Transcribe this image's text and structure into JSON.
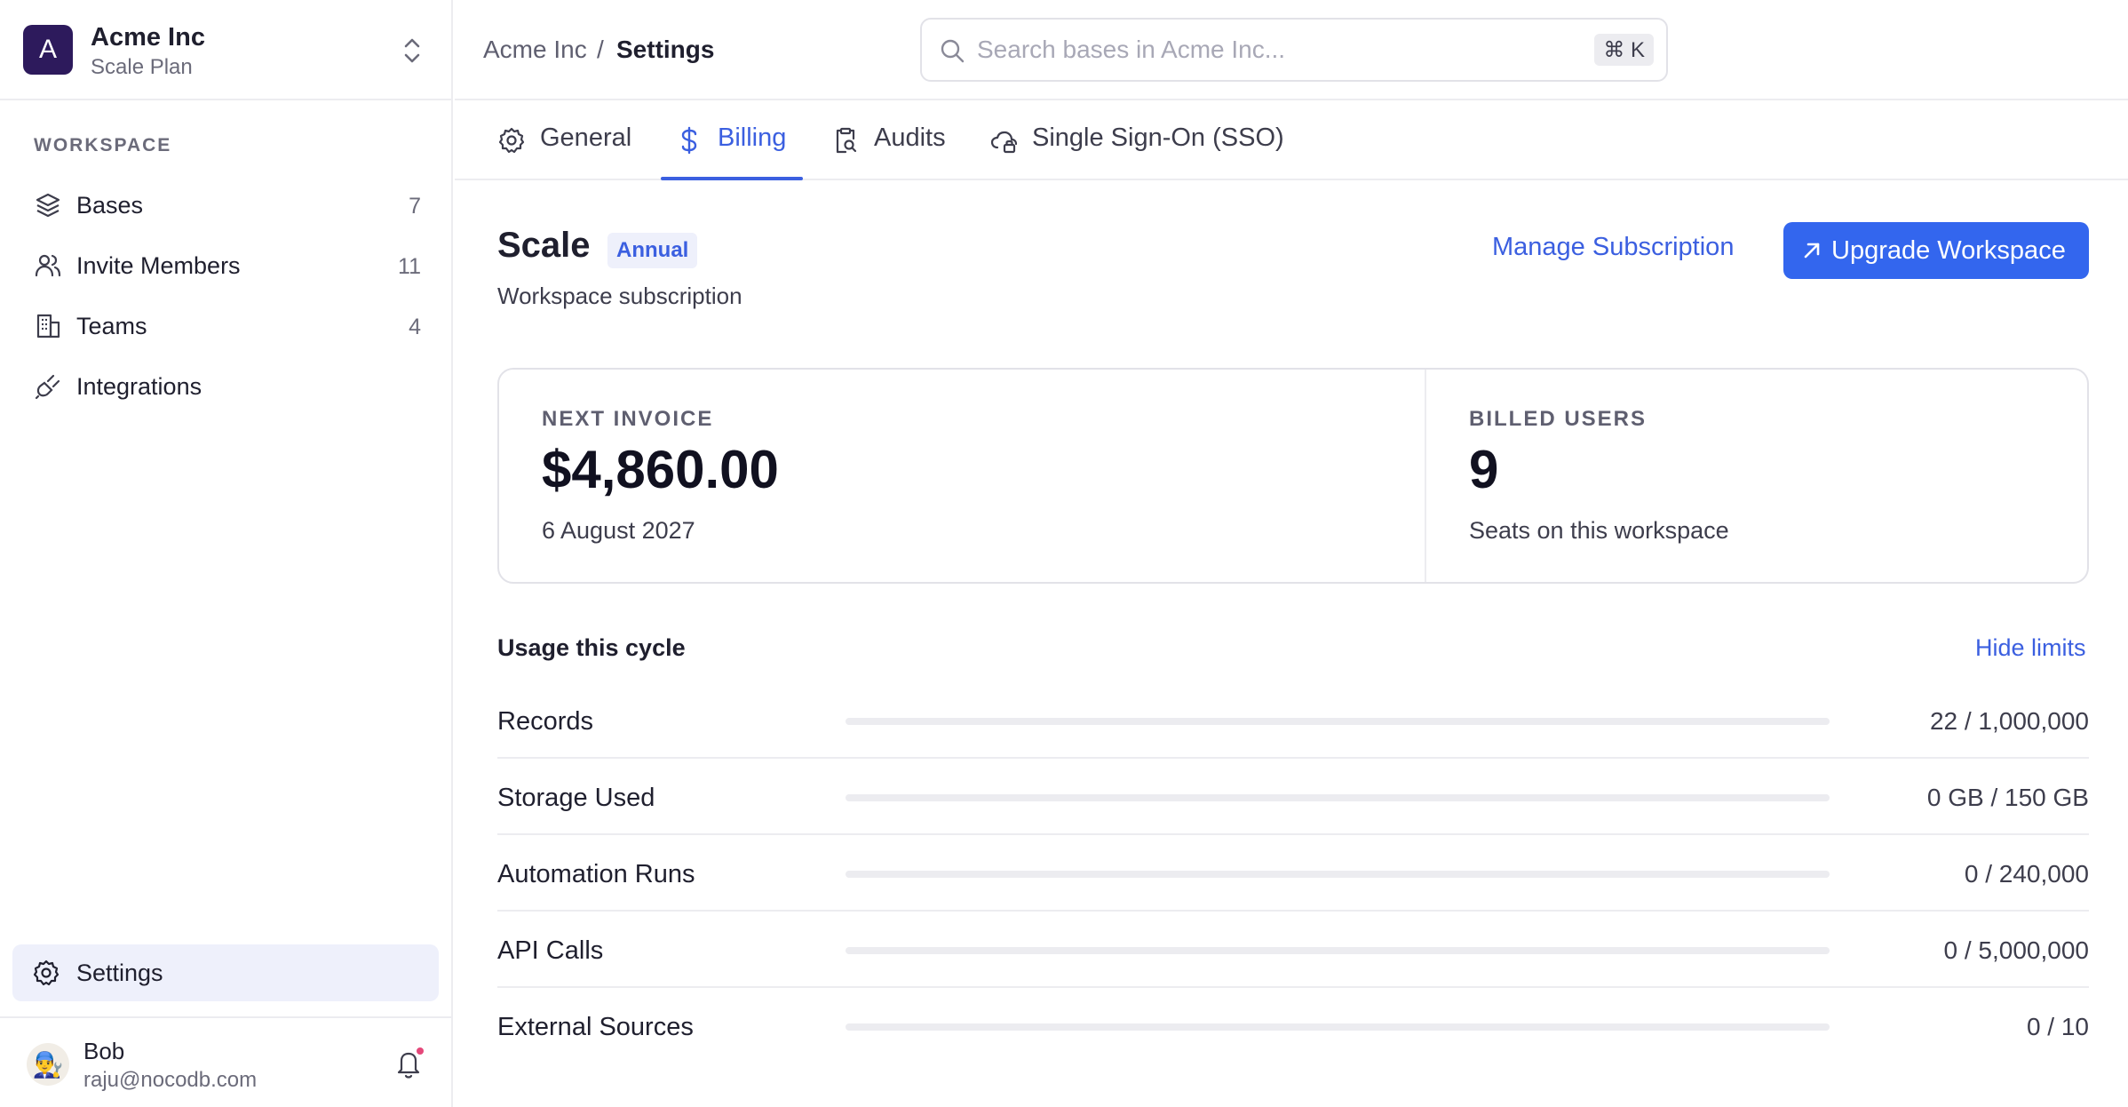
{
  "workspace": {
    "avatar_letter": "A",
    "name": "Acme Inc",
    "plan": "Scale Plan"
  },
  "sidebar": {
    "section_label": "WORKSPACE",
    "items": [
      {
        "label": "Bases",
        "count": "7",
        "icon": "layers-icon"
      },
      {
        "label": "Invite Members",
        "count": "11",
        "icon": "users-icon"
      },
      {
        "label": "Teams",
        "count": "4",
        "icon": "building-icon"
      },
      {
        "label": "Integrations",
        "count": "",
        "icon": "plug-icon"
      }
    ],
    "settings_label": "Settings"
  },
  "user": {
    "name": "Bob",
    "email": "raju@nocodb.com",
    "avatar_emoji": "👨‍🔧"
  },
  "breadcrumb": {
    "parent": "Acme Inc",
    "separator": "/",
    "current": "Settings"
  },
  "search": {
    "placeholder": "Search bases in Acme Inc...",
    "shortcut": "⌘ K"
  },
  "tabs": [
    {
      "label": "General",
      "icon": "gear-icon",
      "active": false
    },
    {
      "label": "Billing",
      "icon": "dollar-icon",
      "active": true
    },
    {
      "label": "Audits",
      "icon": "clipboard-search-icon",
      "active": false
    },
    {
      "label": "Single Sign-On (SSO)",
      "icon": "cloud-lock-icon",
      "active": false
    }
  ],
  "plan": {
    "title": "Scale",
    "badge": "Annual",
    "subtitle": "Workspace subscription",
    "manage_label": "Manage Subscription",
    "upgrade_label": "Upgrade Workspace"
  },
  "stats": {
    "invoice_label": "NEXT INVOICE",
    "invoice_value": "$4,860.00",
    "invoice_date": "6 August 2027",
    "users_label": "BILLED USERS",
    "users_value": "9",
    "users_sub": "Seats on this workspace"
  },
  "usage": {
    "title": "Usage this cycle",
    "toggle_label": "Hide limits",
    "rows": [
      {
        "name": "Records",
        "value": "22 / 1,000,000",
        "fraction": 2.2e-05
      },
      {
        "name": "Storage Used",
        "value": "0 GB / 150 GB",
        "fraction": 0
      },
      {
        "name": "Automation Runs",
        "value": "0 / 240,000",
        "fraction": 0
      },
      {
        "name": "API Calls",
        "value": "0 / 5,000,000",
        "fraction": 0
      },
      {
        "name": "External Sources",
        "value": "0 / 10",
        "fraction": 0
      }
    ]
  },
  "colors": {
    "accent": "#3b5fe0",
    "primary_button": "#3366ee",
    "workspace_avatar": "#2d1a5c",
    "notification_dot": "#e5487a"
  }
}
